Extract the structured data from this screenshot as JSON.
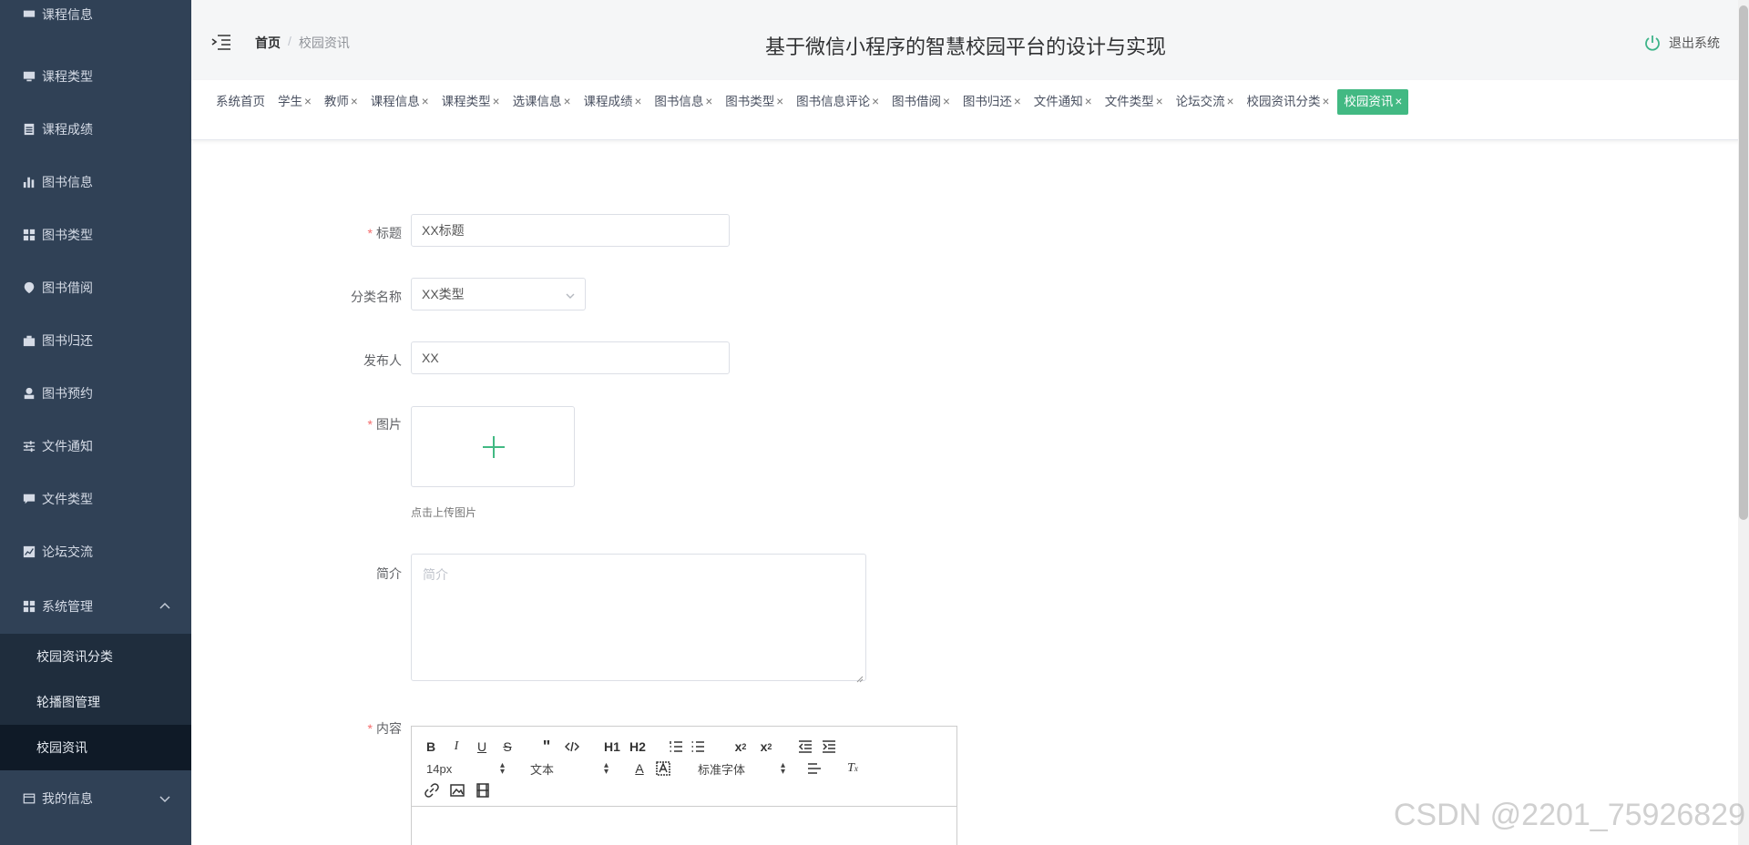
{
  "sidebar": {
    "top_partial": "课程信息",
    "items": [
      {
        "label": "课程类型",
        "icon": "monitor-icon"
      },
      {
        "label": "课程成绩",
        "icon": "clipboard-icon"
      },
      {
        "label": "图书信息",
        "icon": "bar-chart-icon"
      },
      {
        "label": "图书类型",
        "icon": "grid-icon"
      },
      {
        "label": "图书借阅",
        "icon": "location-pin-icon"
      },
      {
        "label": "图书归还",
        "icon": "briefcase-icon"
      },
      {
        "label": "图书预约",
        "icon": "user-icon"
      },
      {
        "label": "文件通知",
        "icon": "sliders-icon"
      },
      {
        "label": "文件类型",
        "icon": "comment-icon"
      },
      {
        "label": "论坛交流",
        "icon": "chart-box-icon"
      },
      {
        "label": "系统管理",
        "icon": "grid-icon"
      }
    ],
    "sub_items": [
      "校园资讯分类",
      "轮播图管理",
      "校园资讯"
    ],
    "bottom_item": "我的信息"
  },
  "header": {
    "breadcrumb_home": "首页",
    "breadcrumb_sep": "/",
    "breadcrumb_current": "校园资讯",
    "title": "基于微信小程序的智慧校园平台的设计与实现",
    "logout": "退出系统"
  },
  "tabs": [
    {
      "label": "系统首页",
      "closable": false
    },
    {
      "label": "学生",
      "closable": true
    },
    {
      "label": "教师",
      "closable": true
    },
    {
      "label": "课程信息",
      "closable": true
    },
    {
      "label": "课程类型",
      "closable": true
    },
    {
      "label": "选课信息",
      "closable": true
    },
    {
      "label": "课程成绩",
      "closable": true
    },
    {
      "label": "图书信息",
      "closable": true
    },
    {
      "label": "图书类型",
      "closable": true
    },
    {
      "label": "图书信息评论",
      "closable": true
    },
    {
      "label": "图书借阅",
      "closable": true
    },
    {
      "label": "图书归还",
      "closable": true
    },
    {
      "label": "文件通知",
      "closable": true
    },
    {
      "label": "文件类型",
      "closable": true
    },
    {
      "label": "论坛交流",
      "closable": true
    },
    {
      "label": "校园资讯分类",
      "closable": true
    },
    {
      "label": "校园资讯",
      "closable": true,
      "active": true
    }
  ],
  "tab_close": "×",
  "form": {
    "required_mark": "*",
    "title_label": "标题",
    "title_value": "XX标题",
    "category_label": "分类名称",
    "category_value": "XX类型",
    "publisher_label": "发布人",
    "publisher_value": "XX",
    "image_label": "图片",
    "upload_tip": "点击上传图片",
    "intro_label": "简介",
    "intro_placeholder": "简介",
    "content_label": "内容"
  },
  "editor": {
    "font_size": "14px",
    "text_type": "文本",
    "font_family": "标准字体",
    "h1": "H1",
    "h2": "H2"
  },
  "watermark": "CSDN @2201_75926829",
  "colors": {
    "accent": "#42b983",
    "sidebar": "#304156",
    "required": "#f56c6c"
  }
}
